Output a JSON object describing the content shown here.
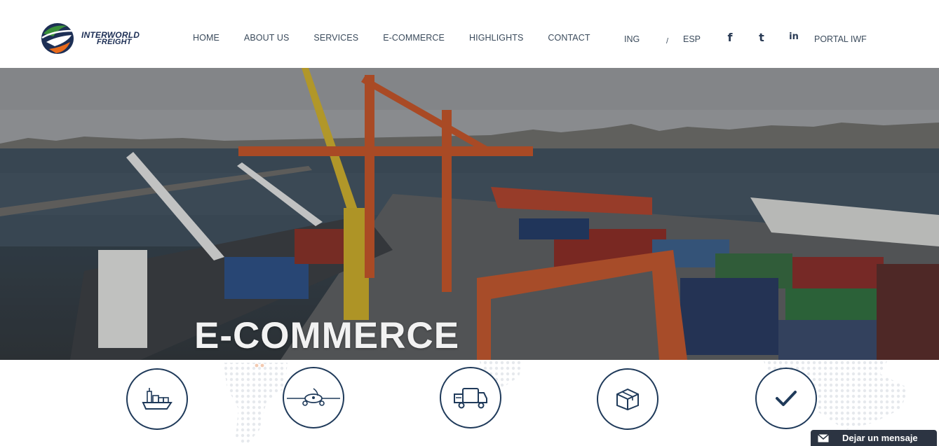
{
  "brand": {
    "line1": "INTERWORLD",
    "line2": "FREIGHT",
    "colors": {
      "navy": "#1d2f55",
      "green": "#3a8f3a",
      "orange": "#e86a1a"
    }
  },
  "nav": {
    "items": [
      {
        "label": "HOME"
      },
      {
        "label": "ABOUT US"
      },
      {
        "label": "SERVICES"
      },
      {
        "label": "E-COMMERCE"
      },
      {
        "label": "HIGHLIGHTS"
      },
      {
        "label": "CONTACT"
      }
    ]
  },
  "language": {
    "ing": "ING",
    "separator": "/",
    "esp": "ESP"
  },
  "social": {
    "facebook": {
      "icon": "facebook-icon",
      "glyph": "f"
    },
    "twitter": {
      "icon": "twitter-icon",
      "glyph": "t"
    },
    "linkedin": {
      "icon": "linkedin-icon",
      "glyph": "in"
    }
  },
  "portal": {
    "label": "PORTAL IWF"
  },
  "hero": {
    "title": "E-COMMERCE"
  },
  "services": [
    {
      "icon": "ship-icon"
    },
    {
      "icon": "airplane-icon"
    },
    {
      "icon": "truck-icon"
    },
    {
      "icon": "package-icon"
    },
    {
      "icon": "checkmark-icon"
    }
  ],
  "chat": {
    "label": "Dejar un mensaje",
    "icon": "envelope-icon",
    "color": "#2c3442"
  }
}
